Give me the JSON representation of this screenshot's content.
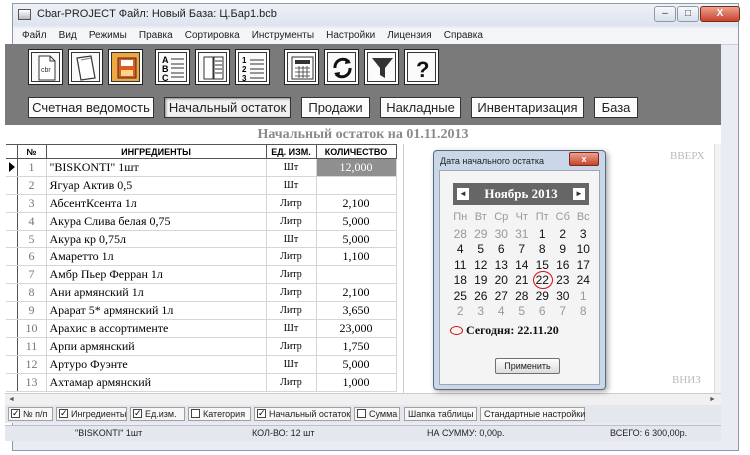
{
  "window": {
    "title": "Cbar-PROJECT  Файл: Новый  База: Ц.Бар1.bcb",
    "minimize_glyph": "–",
    "maximize_glyph": "□",
    "close_glyph": "X"
  },
  "menu": [
    "Файл",
    "Вид",
    "Режимы",
    "Правка",
    "Сортировка",
    "Инструменты",
    "Настройки",
    "Лицензия",
    "Справка"
  ],
  "toolbar": {
    "icons": [
      "cbr-file-icon",
      "open-folder-icon",
      "save-icon",
      "sort-alpha-icon",
      "sort-table-icon",
      "sort-numeric-icon",
      "calculator-icon",
      "refresh-icon",
      "filter-icon",
      "help-icon"
    ],
    "cbr_text": "cbr",
    "help_text": "?"
  },
  "tabs": [
    "Счетная ведомость",
    "Начальный остаток",
    "Продажи",
    "Накладные",
    "Инвентаризация",
    "База"
  ],
  "active_tab": "Начальный остаток",
  "heading": "Начальный остаток на 01.11.2013",
  "table": {
    "headers": [
      "№",
      "ИНГРЕДИЕНТЫ",
      "ЕД. ИЗМ.",
      "КОЛИЧЕСТВО"
    ],
    "rows": [
      {
        "n": "1",
        "name": "\"BISKONTI\" 1шт",
        "unit": "Шт",
        "qty": "12,000"
      },
      {
        "n": "2",
        "name": "Ягуар Актив 0,5",
        "unit": "Шт",
        "qty": ""
      },
      {
        "n": "3",
        "name": "АбсентКсента 1л",
        "unit": "Литр",
        "qty": "2,100"
      },
      {
        "n": "4",
        "name": "Акура Слива белая 0,75",
        "unit": "Литр",
        "qty": "5,000"
      },
      {
        "n": "5",
        "name": "Акура кр 0,75л",
        "unit": "Шт",
        "qty": "5,000"
      },
      {
        "n": "6",
        "name": "Амаретто 1л",
        "unit": "Литр",
        "qty": "1,100"
      },
      {
        "n": "7",
        "name": "Амбр Пьер Ферран 1л",
        "unit": "Литр",
        "qty": ""
      },
      {
        "n": "8",
        "name": "Ани армянский 1л",
        "unit": "Литр",
        "qty": "2,100"
      },
      {
        "n": "9",
        "name": "Арарат 5* армянский 1л",
        "unit": "Литр",
        "qty": "3,650"
      },
      {
        "n": "10",
        "name": "Арахис в ассортименте",
        "unit": "Шт",
        "qty": "23,000"
      },
      {
        "n": "11",
        "name": "Арпи армянский",
        "unit": "Литр",
        "qty": "1,750"
      },
      {
        "n": "12",
        "name": "Артуро Фуэнте",
        "unit": "Шт",
        "qty": "5,000"
      },
      {
        "n": "13",
        "name": "Ахтамар армянский",
        "unit": "Литр",
        "qty": "1,000"
      }
    ]
  },
  "scroll_labels": {
    "up": "ВВЕРХ",
    "down": "ВНИЗ"
  },
  "date_dialog": {
    "title": "Дата начального остатка",
    "close_glyph": "x",
    "month_label": "Ноябрь 2013",
    "prev_glyph": "◄",
    "next_glyph": "►",
    "weekdays": [
      "Пн",
      "Вт",
      "Ср",
      "Чт",
      "Пт",
      "Сб",
      "Вс"
    ],
    "weeks": [
      [
        "28",
        "29",
        "30",
        "31",
        "1",
        "2",
        "3"
      ],
      [
        "4",
        "5",
        "6",
        "7",
        "8",
        "9",
        "10"
      ],
      [
        "11",
        "12",
        "13",
        "14",
        "15",
        "16",
        "17"
      ],
      [
        "18",
        "19",
        "20",
        "21",
        "22",
        "23",
        "24"
      ],
      [
        "25",
        "26",
        "27",
        "28",
        "29",
        "30",
        "1"
      ],
      [
        "2",
        "3",
        "4",
        "5",
        "6",
        "7",
        "8"
      ]
    ],
    "today_text": "Сегодня: 22.11.20",
    "apply_label": "Применить"
  },
  "options": [
    {
      "label": "№ п/п",
      "checked": true
    },
    {
      "label": "Ингредиенты",
      "checked": true
    },
    {
      "label": "Ед.изм.",
      "checked": true
    },
    {
      "label": "Категория",
      "checked": false
    },
    {
      "label": "Начальный остаток",
      "checked": true
    },
    {
      "label": "Сумма",
      "checked": false
    }
  ],
  "buttons": {
    "table_header": "Шапка таблицы",
    "default_settings": "Стандартные настройки"
  },
  "status": {
    "selected": "\"BISKONTI\" 1шт",
    "count": "КОЛ-ВО: 12 шт",
    "sum": "НА СУММУ: 0,00р.",
    "total": "ВСЕГО: 6 300,00р."
  }
}
